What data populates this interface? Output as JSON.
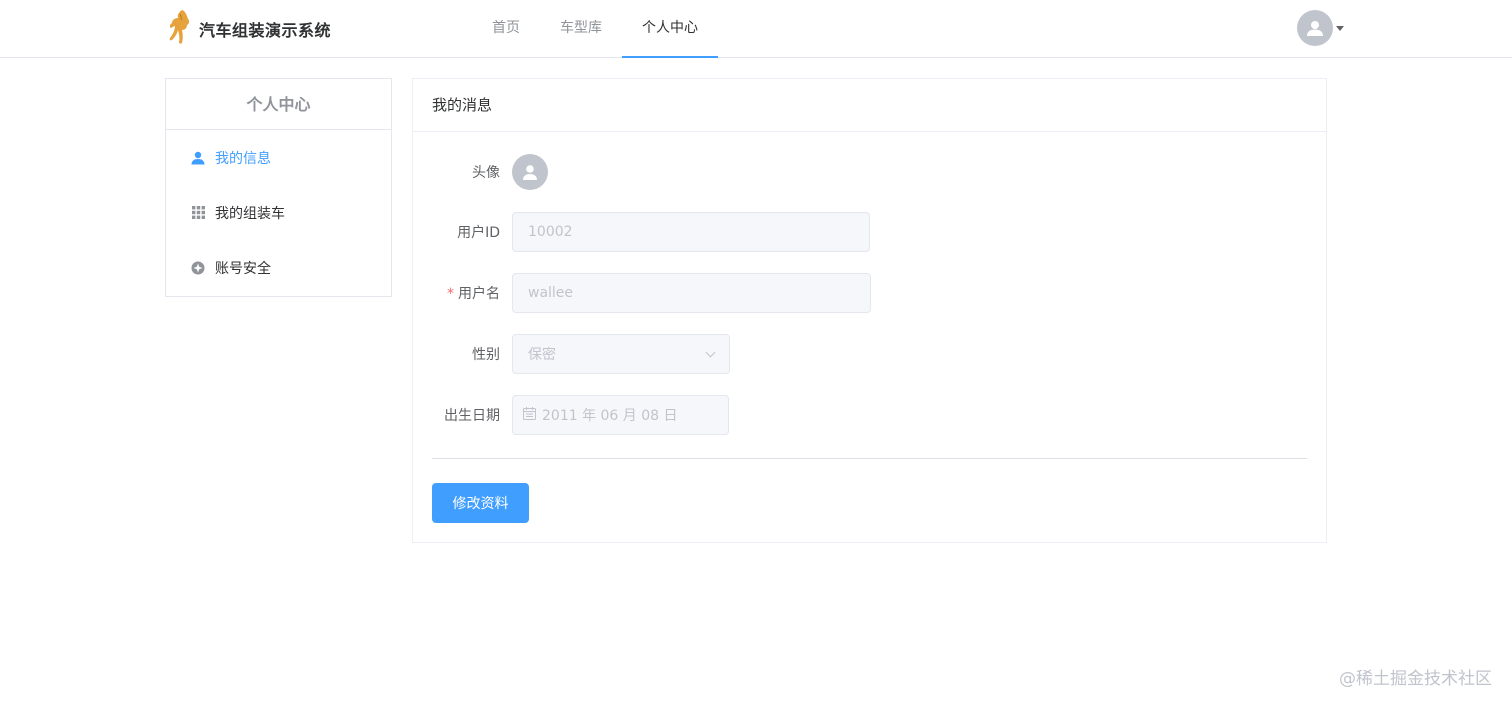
{
  "app": {
    "title": "汽车组装演示系统",
    "logo_icon": "horse-logo-icon"
  },
  "nav": {
    "items": [
      {
        "label": "首页"
      },
      {
        "label": "车型库"
      },
      {
        "label": "个人中心"
      }
    ],
    "active_index": 2
  },
  "user_menu": {
    "avatar_icon": "user-avatar-icon",
    "caret_icon": "caret-down-icon"
  },
  "sidebar": {
    "title": "个人中心",
    "items": [
      {
        "label": "我的信息",
        "icon": "user-icon",
        "active": true
      },
      {
        "label": "我的组装车",
        "icon": "grid-icon",
        "active": false
      },
      {
        "label": "账号安全",
        "icon": "shield-icon",
        "active": false
      }
    ]
  },
  "main": {
    "title": "我的消息",
    "form": {
      "avatar_label": "头像",
      "user_id_label": "用户ID",
      "user_id_value": "10002",
      "username_required_mark": "*",
      "username_label": "用户名",
      "username_value": "wallee",
      "gender_label": "性别",
      "gender_value": "保密",
      "birthday_label": "出生日期",
      "birthday_value": "2011 年 06 月 08 日"
    },
    "submit_label": "修改资料"
  },
  "watermark": "@稀土掘金技术社区",
  "colors": {
    "accent": "#409eff",
    "muted": "#909399",
    "input_bg": "#f5f7fa",
    "required": "#f56c6c"
  }
}
